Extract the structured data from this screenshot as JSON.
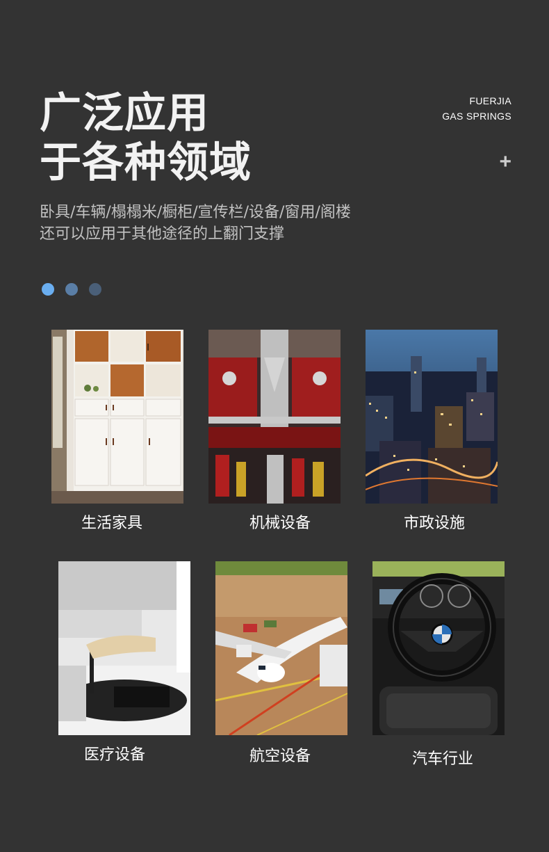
{
  "header": {
    "title_line1": "广泛应用",
    "title_line2": "于各种领域",
    "brand_line1": "FUERJIA",
    "brand_line2": "GAS SPRINGS",
    "plus_symbol": "+"
  },
  "description": {
    "line1": "卧具/车辆/榻榻米/橱柜/宣传栏/设备/窗用/阁楼",
    "line2": "还可以应用于其他途径的上翻门支撑"
  },
  "pager": {
    "dot_colors": [
      "#6aaef0",
      "#5a7ea6",
      "#4a5f78"
    ]
  },
  "applications": [
    {
      "label": "生活家具",
      "image": "furniture-cabinet-photo"
    },
    {
      "label": "机械设备",
      "image": "machinery-photo"
    },
    {
      "label": "市政设施",
      "image": "city-night-photo"
    },
    {
      "label": "医疗设备",
      "image": "medical-lab-photo"
    },
    {
      "label": "航空设备",
      "image": "airplane-photo"
    },
    {
      "label": "汽车行业",
      "image": "car-interior-photo"
    }
  ],
  "colors": {
    "background": "#333333",
    "title": "#f2f2f2",
    "description": "#c2c2c2"
  }
}
